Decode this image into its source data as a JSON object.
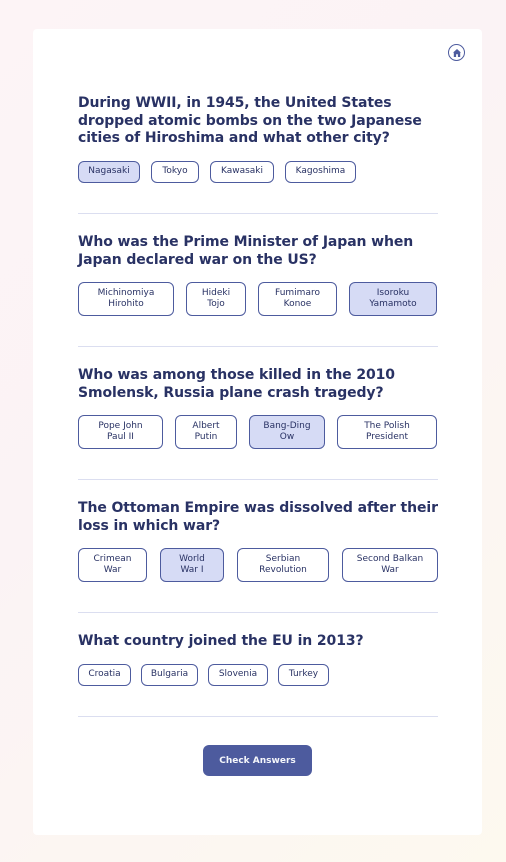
{
  "colors": {
    "accent": "#4d5b9e",
    "text": "#293264",
    "selected_bg": "#d6dbf5",
    "divider": "#dbdef0"
  },
  "header": {
    "home_icon": "home-icon"
  },
  "questions": [
    {
      "text": "During WWII, in 1945, the United States dropped atomic bombs on the two Japanese cities of Hiroshima and what other city?",
      "options": [
        "Nagasaki",
        "Tokyo",
        "Kawasaki",
        "Kagoshima"
      ],
      "selected": "Nagasaki"
    },
    {
      "text": "Who was the Prime Minister of Japan when Japan declared war on the US?",
      "options": [
        "Michinomiya Hirohito",
        "Hideki Tojo",
        "Fumimaro Konoe",
        "Isoroku Yamamoto"
      ],
      "selected": "Isoroku Yamamoto"
    },
    {
      "text": "Who was among those killed in the 2010 Smolensk, Russia plane crash tragedy?",
      "options": [
        "Pope John Paul II",
        "Albert Putin",
        "Bang-Ding Ow",
        "The Polish President"
      ],
      "selected": "Bang-Ding Ow"
    },
    {
      "text": "The Ottoman Empire was dissolved after their loss in which war?",
      "options": [
        "Crimean War",
        "World War I",
        "Serbian Revolution",
        "Second Balkan War"
      ],
      "selected": "World War I"
    },
    {
      "text": "What country joined the EU in 2013?",
      "options": [
        "Croatia",
        "Bulgaria",
        "Slovenia",
        "Turkey"
      ],
      "selected": null
    }
  ],
  "check_button_label": "Check Answers"
}
